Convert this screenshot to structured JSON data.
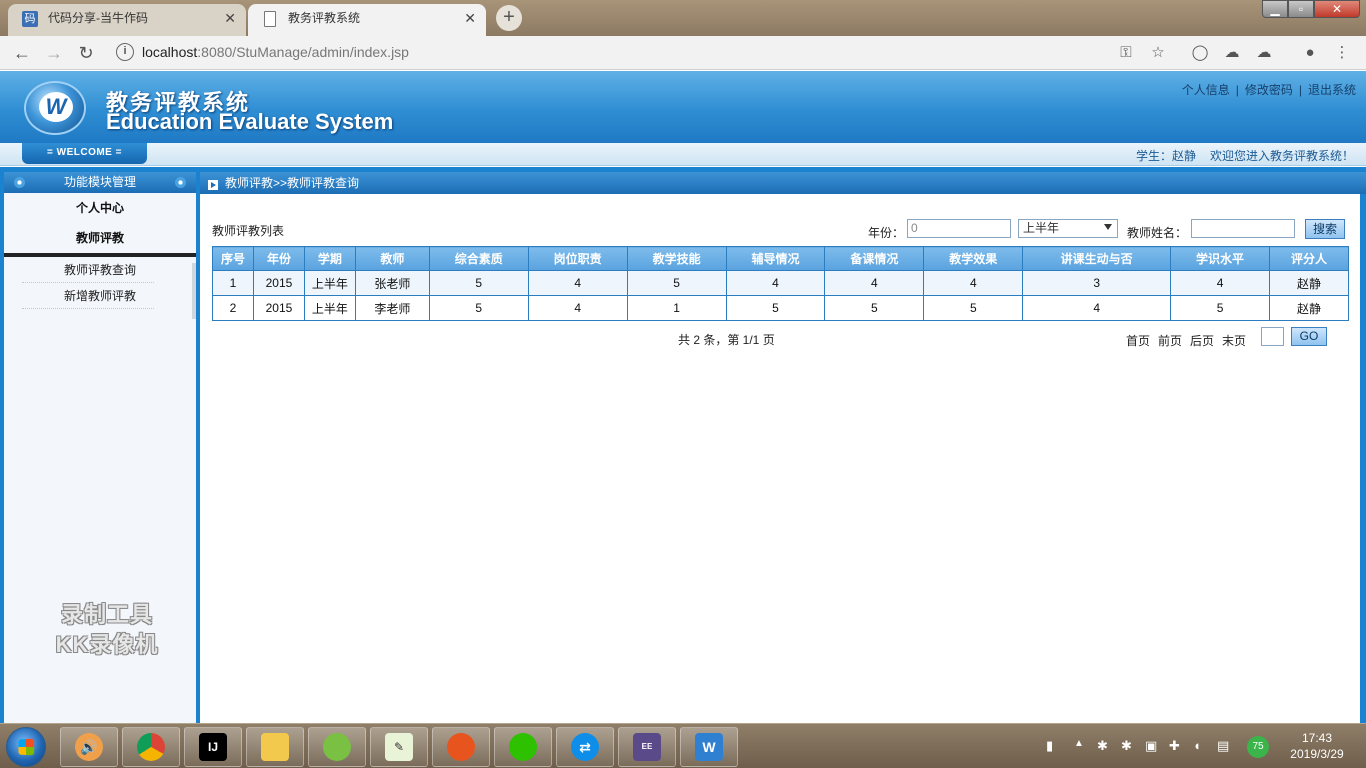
{
  "browser": {
    "tabs": [
      {
        "title": "代码分享-当牛作码",
        "favicon": "码",
        "active": false
      },
      {
        "title": "教务评教系统",
        "active": true
      }
    ],
    "url_host": "localhost",
    "url_rest": ":8080/StuManage/admin/index.jsp"
  },
  "header": {
    "logo_letter": "W",
    "title_cn": "教务评教系统",
    "title_en": "Education Evaluate System",
    "links": [
      "个人信息",
      "修改密码",
      "退出系统"
    ],
    "welcome": "= WELCOME =",
    "user_label": "学生：赵静",
    "greeting": "欢迎您进入教务评教系统！"
  },
  "sidebar": {
    "heading": "功能模块管理",
    "sections": [
      {
        "label": "个人中心"
      },
      {
        "label": "教师评教",
        "items": [
          "教师评教查询",
          "新增教师评教"
        ]
      }
    ],
    "watermark": [
      "录制工具",
      "KK录像机"
    ]
  },
  "content": {
    "breadcrumb": "教师评教>>教师评教查询",
    "list_title": "教师评教列表",
    "filters": {
      "year_label": "年份：",
      "year_value": "0",
      "term_value": "上半年",
      "teacher_label": "教师姓名：",
      "teacher_value": "",
      "search_label": "搜索"
    },
    "table": {
      "columns": [
        "序号",
        "年份",
        "学期",
        "教师",
        "综合素质",
        "岗位职责",
        "教学技能",
        "辅导情况",
        "备课情况",
        "教学效果",
        "讲课生动与否",
        "学识水平",
        "评分人"
      ],
      "rows": [
        [
          "1",
          "2015",
          "上半年",
          "张老师",
          "5",
          "4",
          "5",
          "4",
          "4",
          "4",
          "3",
          "4",
          "赵静"
        ],
        [
          "2",
          "2015",
          "上半年",
          "李老师",
          "5",
          "4",
          "1",
          "5",
          "5",
          "5",
          "4",
          "5",
          "赵静"
        ]
      ]
    },
    "pager": {
      "info": "共 2 条，第 1/1 页",
      "links": [
        "首页",
        "前页",
        "后页",
        "末页"
      ],
      "page_value": "",
      "go_label": "GO"
    }
  },
  "taskbar": {
    "apps": [
      "volume-app",
      "chrome",
      "intellij-idea",
      "file-explorer",
      "app-green",
      "notepad",
      "app-fox",
      "wechat",
      "teamviewer",
      "javaee-ide",
      "app-w"
    ],
    "badge": "75",
    "time": "17:43",
    "date": "2019/3/29"
  }
}
